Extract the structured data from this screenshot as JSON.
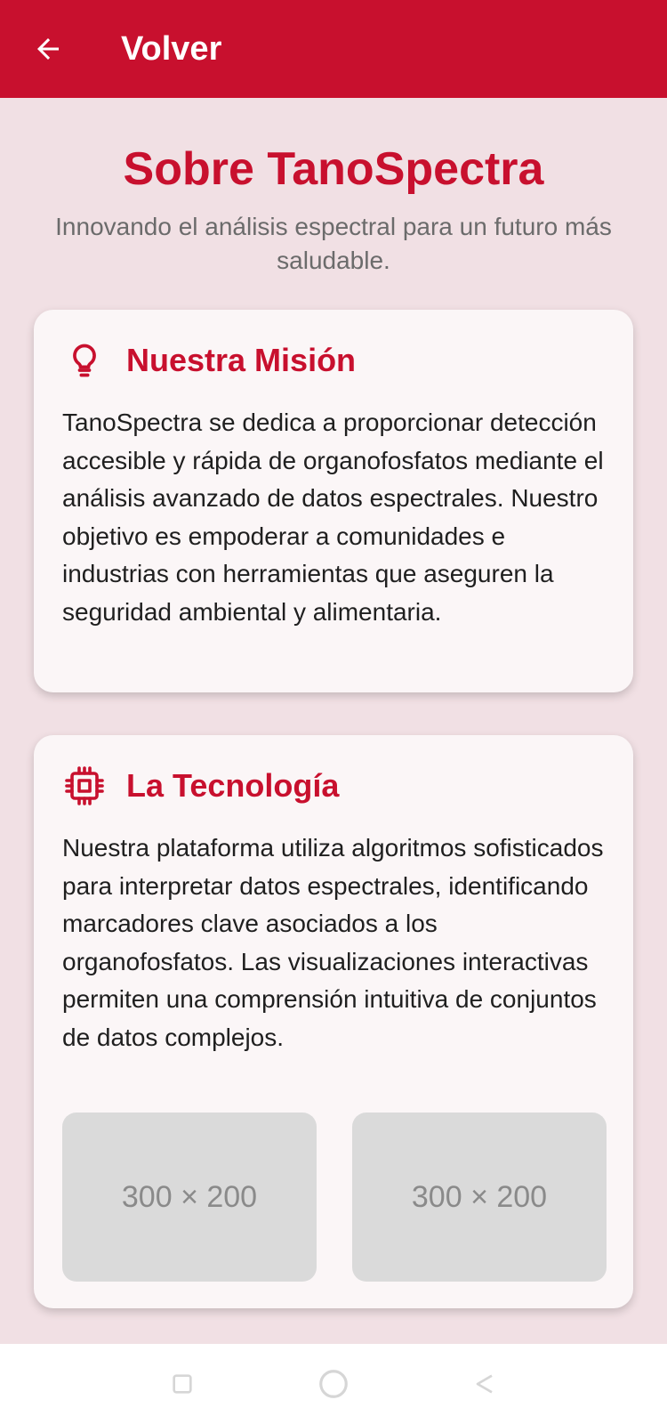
{
  "header": {
    "back_label": "Volver"
  },
  "page": {
    "title": "Sobre TanoSpectra",
    "subtitle": "Innovando el análisis espectral para un futuro más saludable."
  },
  "mission": {
    "icon": "lightbulb-icon",
    "title": "Nuestra Misión",
    "body": "TanoSpectra se dedica a proporcionar detección accesible y rápida de organofosfatos mediante el análisis avanzado de datos espectrales. Nuestro objetivo es empoderar a comunidades e industrias con herramientas que aseguren la seguridad ambiental y alimentaria."
  },
  "technology": {
    "icon": "chip-icon",
    "title": "La Tecnología",
    "body": "Nuestra plataforma utiliza algoritmos sofisticados para interpretar datos espectrales, identificando marcadores clave asociados a los organofosfatos. Las visualizaciones interactivas permiten una comprensión intuitiva de conjuntos de datos complejos.",
    "images": [
      {
        "label": "300 × 200"
      },
      {
        "label": "300 × 200"
      }
    ]
  },
  "colors": {
    "brand": "#c8102e",
    "background": "#f1e0e4",
    "card": "#fbf6f7"
  }
}
